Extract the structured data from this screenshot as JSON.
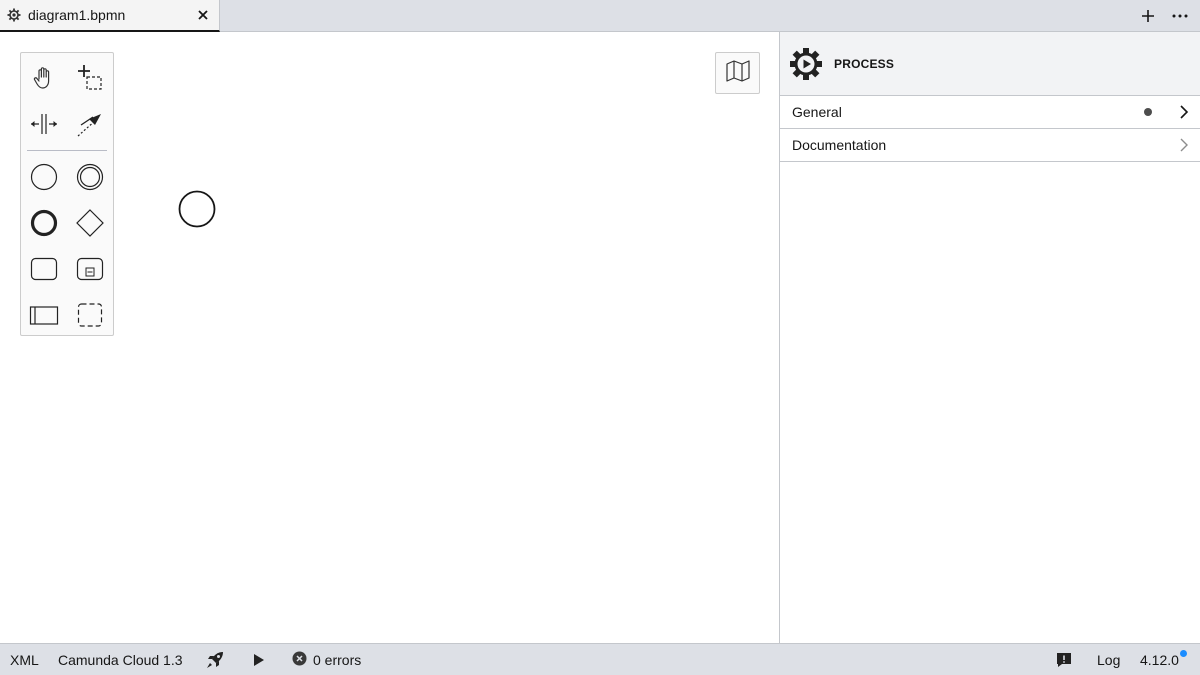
{
  "tabs": [
    {
      "label": "diagram1.bpmn",
      "icon": "gear-icon",
      "active": true
    }
  ],
  "tabbar_actions": {
    "add_icon": "plus-icon",
    "more_icon": "ellipsis-icon"
  },
  "palette": {
    "tools": [
      {
        "name": "hand-tool",
        "icon": "hand-icon"
      },
      {
        "name": "lasso-tool",
        "icon": "lasso-icon"
      },
      {
        "name": "space-tool",
        "icon": "space-icon"
      },
      {
        "name": "global-connect-tool",
        "icon": "connect-icon"
      },
      {
        "name": "create-start-event",
        "icon": "start-event-icon"
      },
      {
        "name": "create-intermediate-event",
        "icon": "intermediate-event-icon"
      },
      {
        "name": "create-end-event",
        "icon": "end-event-icon"
      },
      {
        "name": "create-gateway",
        "icon": "gateway-icon"
      },
      {
        "name": "create-task",
        "icon": "task-icon"
      },
      {
        "name": "create-subprocess",
        "icon": "subprocess-icon"
      },
      {
        "name": "create-pool",
        "icon": "pool-icon"
      },
      {
        "name": "create-group",
        "icon": "group-icon"
      }
    ]
  },
  "canvas": {
    "minimap_icon": "map-icon",
    "elements": [
      {
        "type": "start-event"
      }
    ]
  },
  "properties": {
    "element_type": "PROCESS",
    "icon": "process-gear-icon",
    "groups": [
      {
        "label": "General",
        "has_indicator": true
      },
      {
        "label": "Documentation",
        "has_indicator": false
      }
    ]
  },
  "statusbar": {
    "xml_label": "XML",
    "platform": "Camunda Cloud 1.3",
    "deploy_icon": "rocket-icon",
    "run_icon": "play-icon",
    "errors": "0 errors",
    "feedback_icon": "feedback-icon",
    "log_label": "Log",
    "version": "4.12.0"
  },
  "colors": {
    "accent": "#1a8cff",
    "chrome": "#dde0e6",
    "text": "#161616"
  }
}
